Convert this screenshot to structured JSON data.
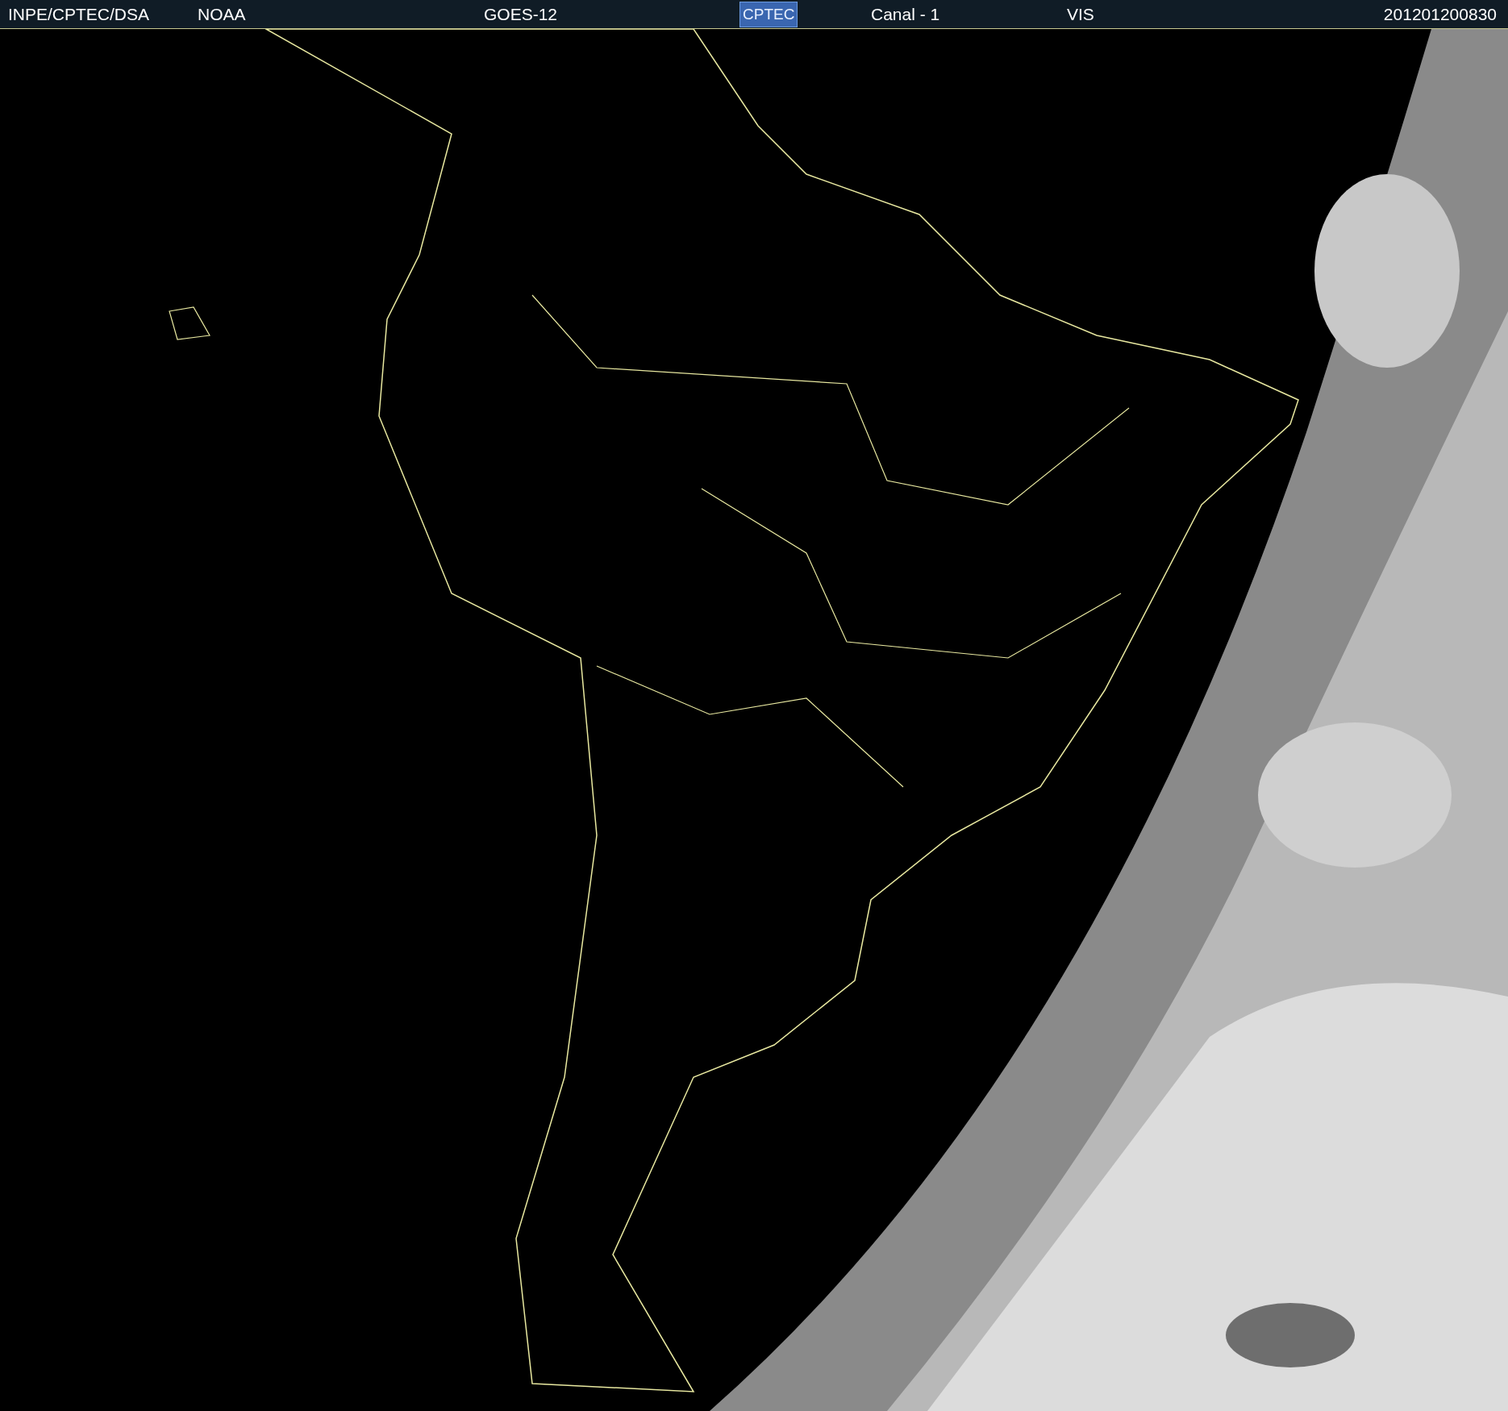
{
  "header": {
    "items": [
      {
        "kind": "text",
        "text": "INPE/CPTEC/DSA"
      },
      {
        "kind": "text",
        "text": "NOAA"
      },
      {
        "kind": "text",
        "text": "GOES-12"
      },
      {
        "kind": "logo",
        "text": "CPTEC"
      },
      {
        "kind": "text",
        "text": "Canal - 1"
      },
      {
        "kind": "text",
        "text": "VIS"
      },
      {
        "kind": "text",
        "text": "201201200830"
      }
    ]
  }
}
